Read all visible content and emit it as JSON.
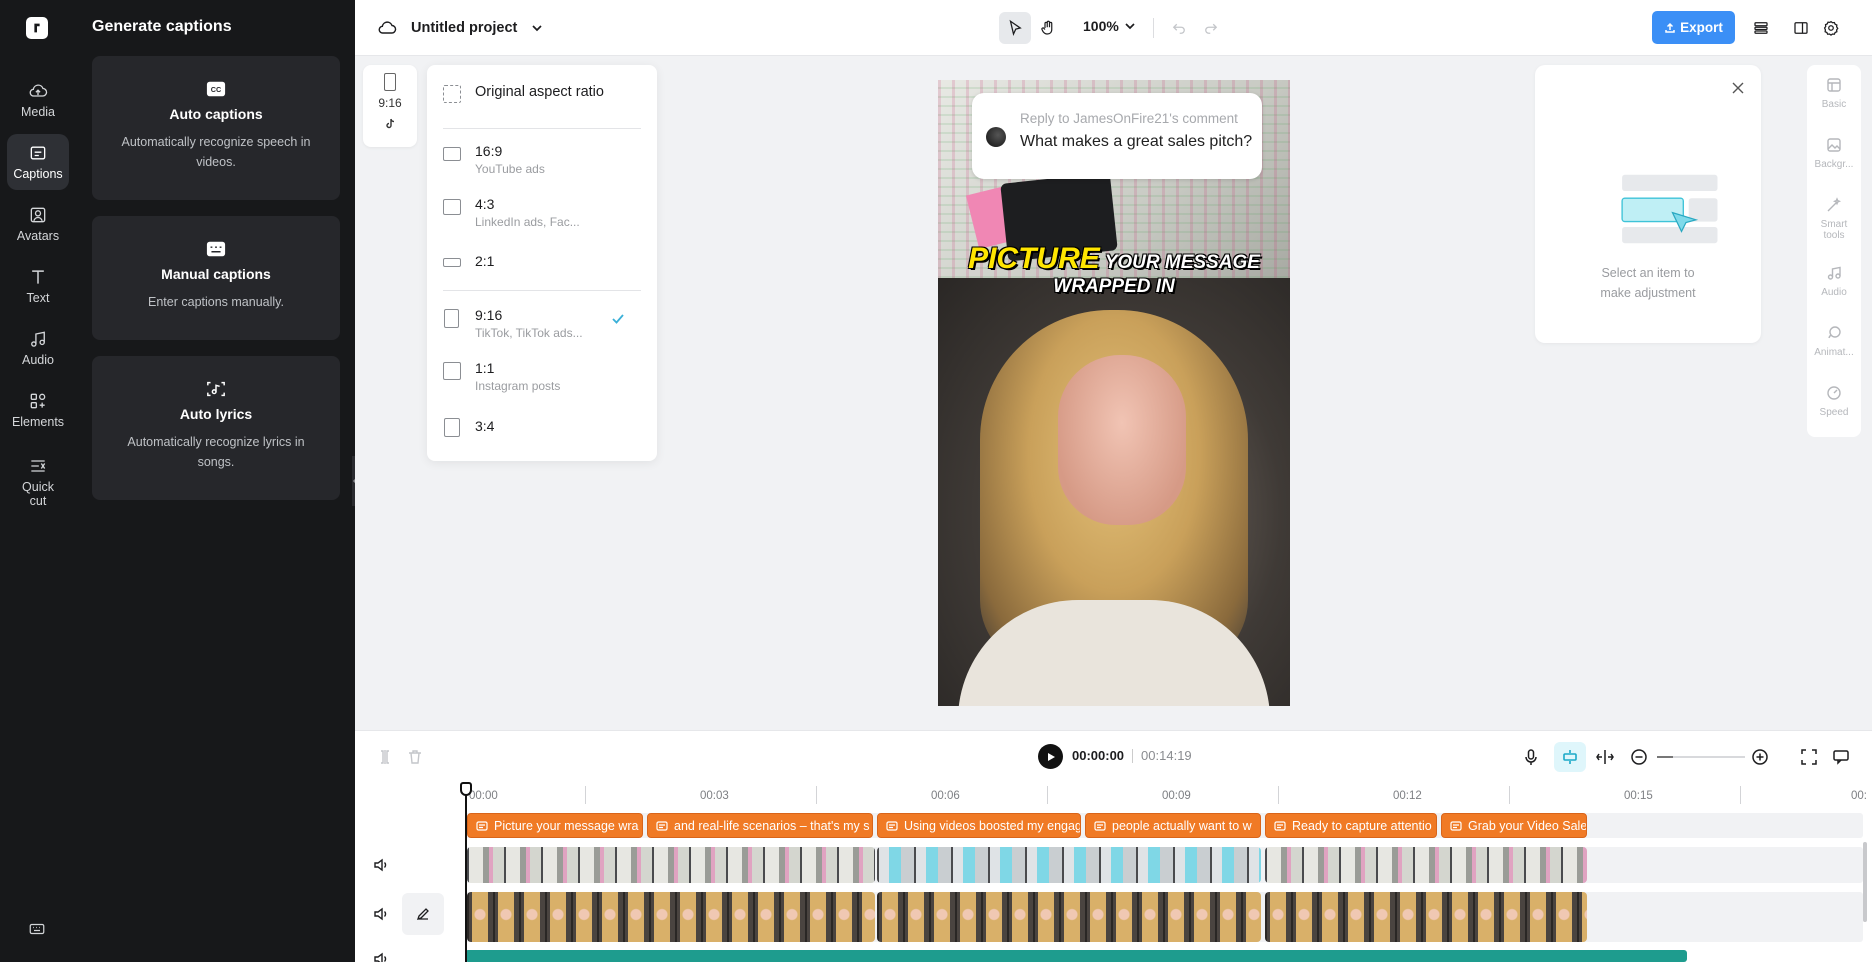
{
  "rail": {
    "items": [
      {
        "label": "Media",
        "icon": "cloud-upload-icon"
      },
      {
        "label": "Captions",
        "icon": "captions-icon",
        "active": true
      },
      {
        "label": "Avatars",
        "icon": "avatar-icon"
      },
      {
        "label": "Text",
        "icon": "text-icon"
      },
      {
        "label": "Audio",
        "icon": "music-note-icon"
      },
      {
        "label": "Elements",
        "icon": "elements-icon"
      },
      {
        "label": "Quick cut",
        "icon": "quick-cut-icon"
      }
    ]
  },
  "captions_panel": {
    "title": "Generate captions",
    "cards": [
      {
        "title": "Auto captions",
        "desc": "Automatically recognize speech in videos.",
        "icon": "cc-icon"
      },
      {
        "title": "Manual captions",
        "desc": "Enter captions manually.",
        "icon": "keyboard-icon"
      },
      {
        "title": "Auto lyrics",
        "desc": "Automatically recognize lyrics in songs.",
        "icon": "lyrics-icon"
      }
    ]
  },
  "topbar": {
    "project_name": "Untitled project",
    "zoom": "100%",
    "export_label": "Export"
  },
  "ratio_pill": {
    "label": "9:16",
    "platform_icon": "tiktok-icon"
  },
  "ratio_menu": {
    "original": "Original aspect ratio",
    "options": [
      {
        "name": "16:9",
        "sub": "YouTube ads"
      },
      {
        "name": "4:3",
        "sub": "LinkedIn ads, Fac..."
      },
      {
        "name": "2:1",
        "sub": ""
      },
      {
        "name": "9:16",
        "sub": "TikTok, TikTok ads...",
        "selected": true
      },
      {
        "name": "1:1",
        "sub": "Instagram posts"
      },
      {
        "name": "3:4",
        "sub": ""
      }
    ]
  },
  "preview": {
    "comment_reply": "Reply to JamesOnFire21's comment",
    "comment_question": "What makes a great sales pitch?",
    "overlay_highlight": "PICTURE",
    "overlay_line1_rest": " YOUR MESSAGE",
    "overlay_line2": "WRAPPED IN"
  },
  "adjust_panel": {
    "message": "Select an item to make adjustment"
  },
  "props": [
    {
      "label": "Basic",
      "icon": "basic-icon"
    },
    {
      "label": "Backgr...",
      "icon": "background-icon"
    },
    {
      "label": "Smart tools",
      "icon": "smart-tools-icon"
    },
    {
      "label": "Audio",
      "icon": "audio-icon"
    },
    {
      "label": "Animat...",
      "icon": "animation-icon"
    },
    {
      "label": "Speed",
      "icon": "speed-icon"
    }
  ],
  "transport": {
    "current_time": "00:00:00",
    "total_time": "00:14:19"
  },
  "timeline": {
    "ruler": [
      "00:00",
      "00:03",
      "00:06",
      "00:09",
      "00:12",
      "00:15",
      "00:"
    ],
    "caption_clips": [
      "Picture your message wra",
      "and real-life scenarios – that's my s",
      "Using videos boosted my engag",
      "people actually want to w",
      "Ready to capture attentio",
      "Grab your Video Sale"
    ]
  },
  "colors": {
    "accent": "#3b8ff6",
    "caption_clip": "#f07a25",
    "sidebar_bg": "#17181a",
    "audio_track": "#1e9c8e"
  }
}
